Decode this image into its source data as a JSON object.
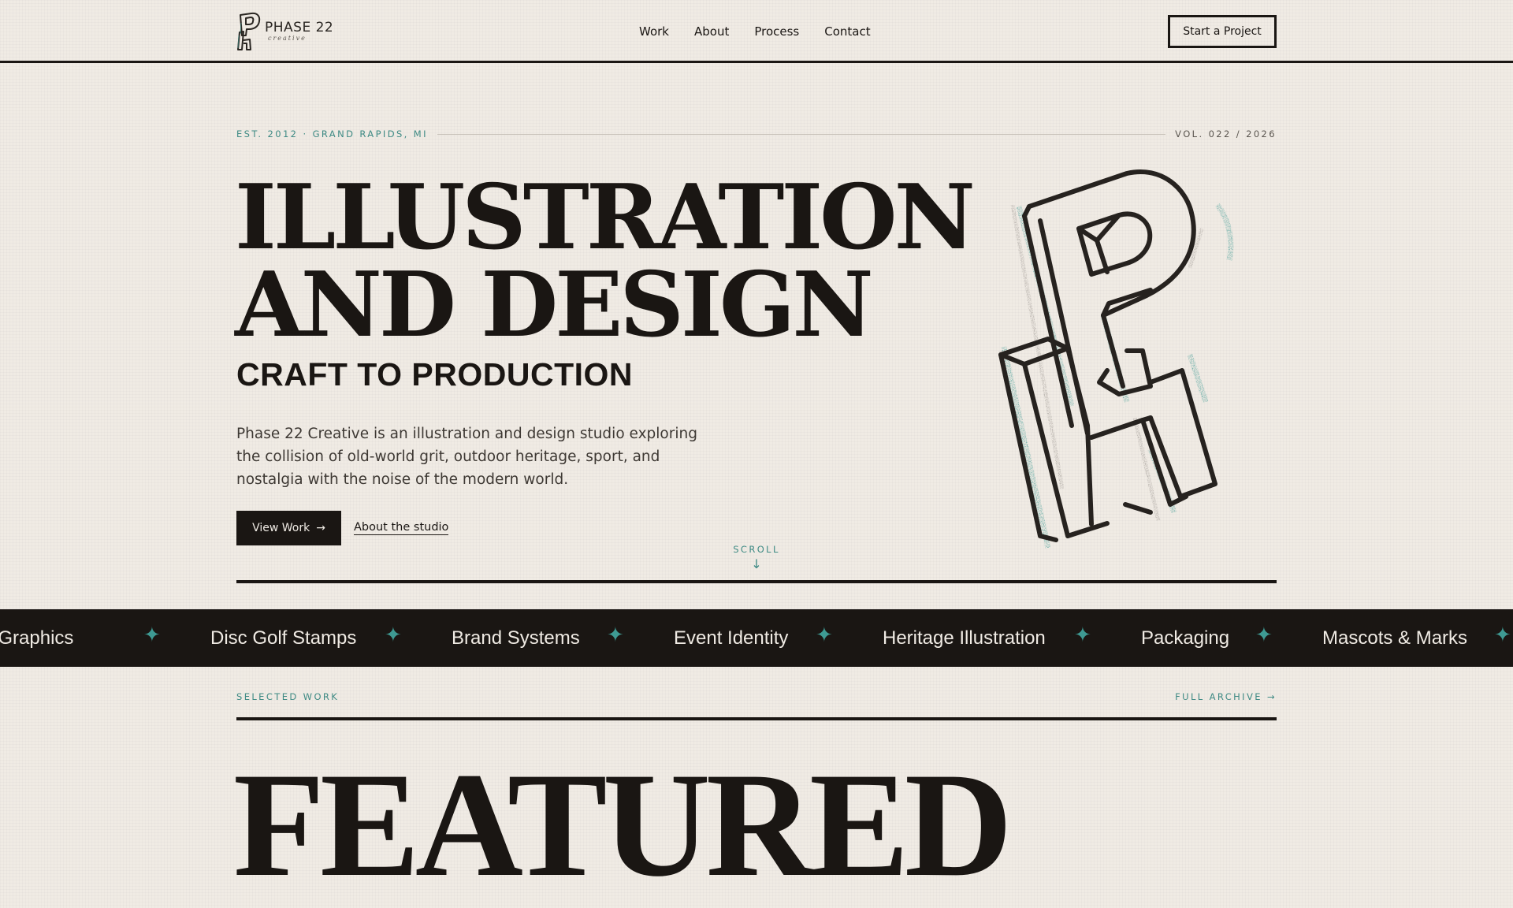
{
  "header": {
    "logo_name": "PHASE 22",
    "logo_sub": "creative",
    "nav": [
      "Work",
      "About",
      "Process",
      "Contact"
    ],
    "cta": "Start a Project"
  },
  "hero": {
    "meta_left": "EST. 2012 · GRAND RAPIDS, MI",
    "meta_right": "VOL. 022 / 2026",
    "title_line1": "ILLUSTRATION",
    "title_line2": "AND DESIGN",
    "subtitle": "CRAFT TO PRODUCTION",
    "description": "Phase 22 Creative is an illustration and design studio exploring the collision of old-world grit, outdoor heritage, sport, and nostalgia with the noise of the modern world.",
    "primary_button": "View Work",
    "primary_arrow": "→",
    "secondary_link": "About the studio",
    "scroll_label": "SCROLL",
    "scroll_arrow": "↓"
  },
  "marquee": {
    "items": [
      "Apparel Graphics",
      "Disc Golf Stamps",
      "Brand Systems",
      "Event Identity",
      "Heritage Illustration",
      "Packaging",
      "Mascots & Marks"
    ],
    "separator": "✦"
  },
  "selected_work": {
    "label": "SELECTED WORK",
    "archive_link": "FULL ARCHIVE →",
    "heading": "FEATURED"
  },
  "colors": {
    "background": "#f0ebe4",
    "ink": "#1a1613",
    "accent_teal": "#3e8a84"
  },
  "icons": {
    "logo": "ph-monogram-icon",
    "hero_art": "isometric-p-h-monogram",
    "marquee_separator": "four-point-star-icon"
  }
}
